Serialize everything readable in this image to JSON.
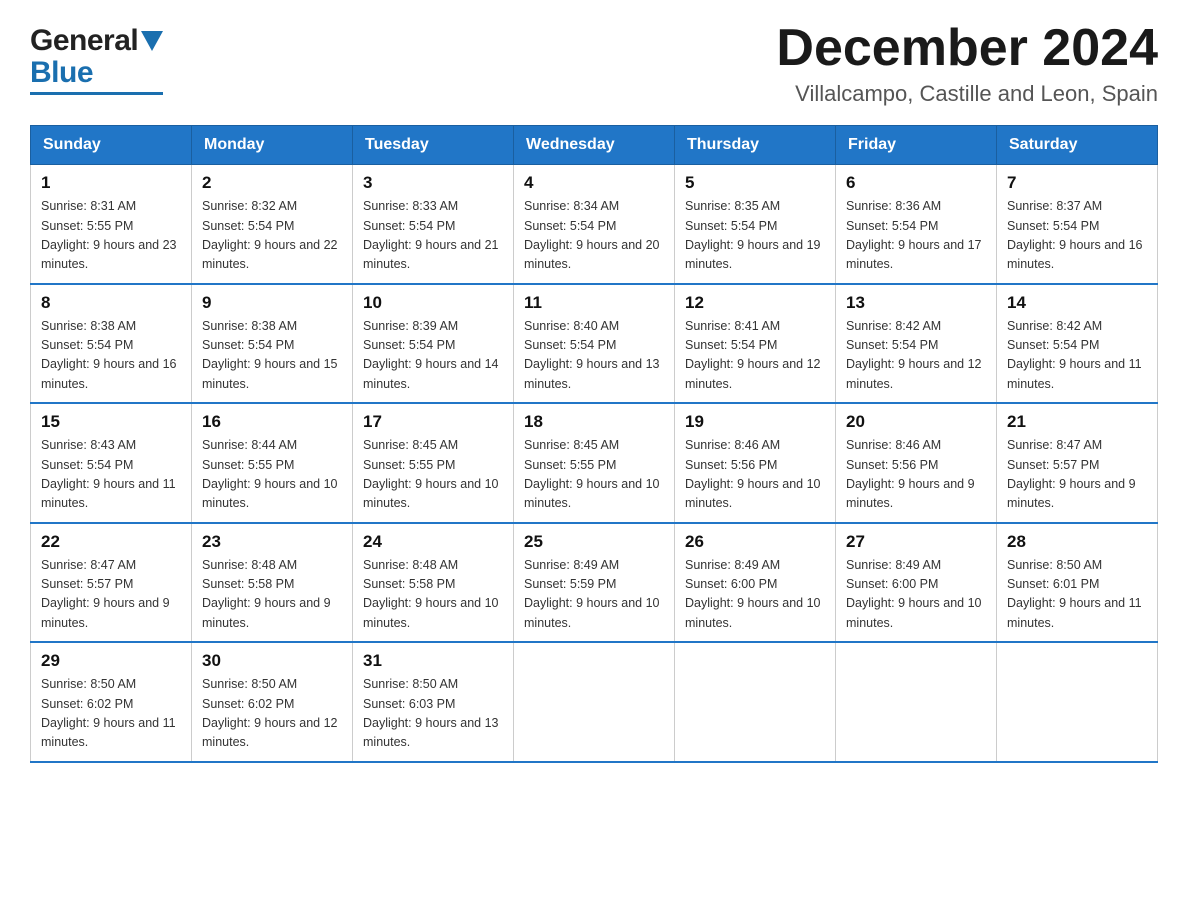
{
  "header": {
    "logo_general": "General",
    "logo_blue": "Blue",
    "month_title": "December 2024",
    "location": "Villalcampo, Castille and Leon, Spain"
  },
  "weekdays": [
    "Sunday",
    "Monday",
    "Tuesday",
    "Wednesday",
    "Thursday",
    "Friday",
    "Saturday"
  ],
  "weeks": [
    [
      {
        "day": "1",
        "sunrise": "8:31 AM",
        "sunset": "5:55 PM",
        "daylight": "9 hours and 23 minutes."
      },
      {
        "day": "2",
        "sunrise": "8:32 AM",
        "sunset": "5:54 PM",
        "daylight": "9 hours and 22 minutes."
      },
      {
        "day": "3",
        "sunrise": "8:33 AM",
        "sunset": "5:54 PM",
        "daylight": "9 hours and 21 minutes."
      },
      {
        "day": "4",
        "sunrise": "8:34 AM",
        "sunset": "5:54 PM",
        "daylight": "9 hours and 20 minutes."
      },
      {
        "day": "5",
        "sunrise": "8:35 AM",
        "sunset": "5:54 PM",
        "daylight": "9 hours and 19 minutes."
      },
      {
        "day": "6",
        "sunrise": "8:36 AM",
        "sunset": "5:54 PM",
        "daylight": "9 hours and 17 minutes."
      },
      {
        "day": "7",
        "sunrise": "8:37 AM",
        "sunset": "5:54 PM",
        "daylight": "9 hours and 16 minutes."
      }
    ],
    [
      {
        "day": "8",
        "sunrise": "8:38 AM",
        "sunset": "5:54 PM",
        "daylight": "9 hours and 16 minutes."
      },
      {
        "day": "9",
        "sunrise": "8:38 AM",
        "sunset": "5:54 PM",
        "daylight": "9 hours and 15 minutes."
      },
      {
        "day": "10",
        "sunrise": "8:39 AM",
        "sunset": "5:54 PM",
        "daylight": "9 hours and 14 minutes."
      },
      {
        "day": "11",
        "sunrise": "8:40 AM",
        "sunset": "5:54 PM",
        "daylight": "9 hours and 13 minutes."
      },
      {
        "day": "12",
        "sunrise": "8:41 AM",
        "sunset": "5:54 PM",
        "daylight": "9 hours and 12 minutes."
      },
      {
        "day": "13",
        "sunrise": "8:42 AM",
        "sunset": "5:54 PM",
        "daylight": "9 hours and 12 minutes."
      },
      {
        "day": "14",
        "sunrise": "8:42 AM",
        "sunset": "5:54 PM",
        "daylight": "9 hours and 11 minutes."
      }
    ],
    [
      {
        "day": "15",
        "sunrise": "8:43 AM",
        "sunset": "5:54 PM",
        "daylight": "9 hours and 11 minutes."
      },
      {
        "day": "16",
        "sunrise": "8:44 AM",
        "sunset": "5:55 PM",
        "daylight": "9 hours and 10 minutes."
      },
      {
        "day": "17",
        "sunrise": "8:45 AM",
        "sunset": "5:55 PM",
        "daylight": "9 hours and 10 minutes."
      },
      {
        "day": "18",
        "sunrise": "8:45 AM",
        "sunset": "5:55 PM",
        "daylight": "9 hours and 10 minutes."
      },
      {
        "day": "19",
        "sunrise": "8:46 AM",
        "sunset": "5:56 PM",
        "daylight": "9 hours and 10 minutes."
      },
      {
        "day": "20",
        "sunrise": "8:46 AM",
        "sunset": "5:56 PM",
        "daylight": "9 hours and 9 minutes."
      },
      {
        "day": "21",
        "sunrise": "8:47 AM",
        "sunset": "5:57 PM",
        "daylight": "9 hours and 9 minutes."
      }
    ],
    [
      {
        "day": "22",
        "sunrise": "8:47 AM",
        "sunset": "5:57 PM",
        "daylight": "9 hours and 9 minutes."
      },
      {
        "day": "23",
        "sunrise": "8:48 AM",
        "sunset": "5:58 PM",
        "daylight": "9 hours and 9 minutes."
      },
      {
        "day": "24",
        "sunrise": "8:48 AM",
        "sunset": "5:58 PM",
        "daylight": "9 hours and 10 minutes."
      },
      {
        "day": "25",
        "sunrise": "8:49 AM",
        "sunset": "5:59 PM",
        "daylight": "9 hours and 10 minutes."
      },
      {
        "day": "26",
        "sunrise": "8:49 AM",
        "sunset": "6:00 PM",
        "daylight": "9 hours and 10 minutes."
      },
      {
        "day": "27",
        "sunrise": "8:49 AM",
        "sunset": "6:00 PM",
        "daylight": "9 hours and 10 minutes."
      },
      {
        "day": "28",
        "sunrise": "8:50 AM",
        "sunset": "6:01 PM",
        "daylight": "9 hours and 11 minutes."
      }
    ],
    [
      {
        "day": "29",
        "sunrise": "8:50 AM",
        "sunset": "6:02 PM",
        "daylight": "9 hours and 11 minutes."
      },
      {
        "day": "30",
        "sunrise": "8:50 AM",
        "sunset": "6:02 PM",
        "daylight": "9 hours and 12 minutes."
      },
      {
        "day": "31",
        "sunrise": "8:50 AM",
        "sunset": "6:03 PM",
        "daylight": "9 hours and 13 minutes."
      },
      null,
      null,
      null,
      null
    ]
  ]
}
